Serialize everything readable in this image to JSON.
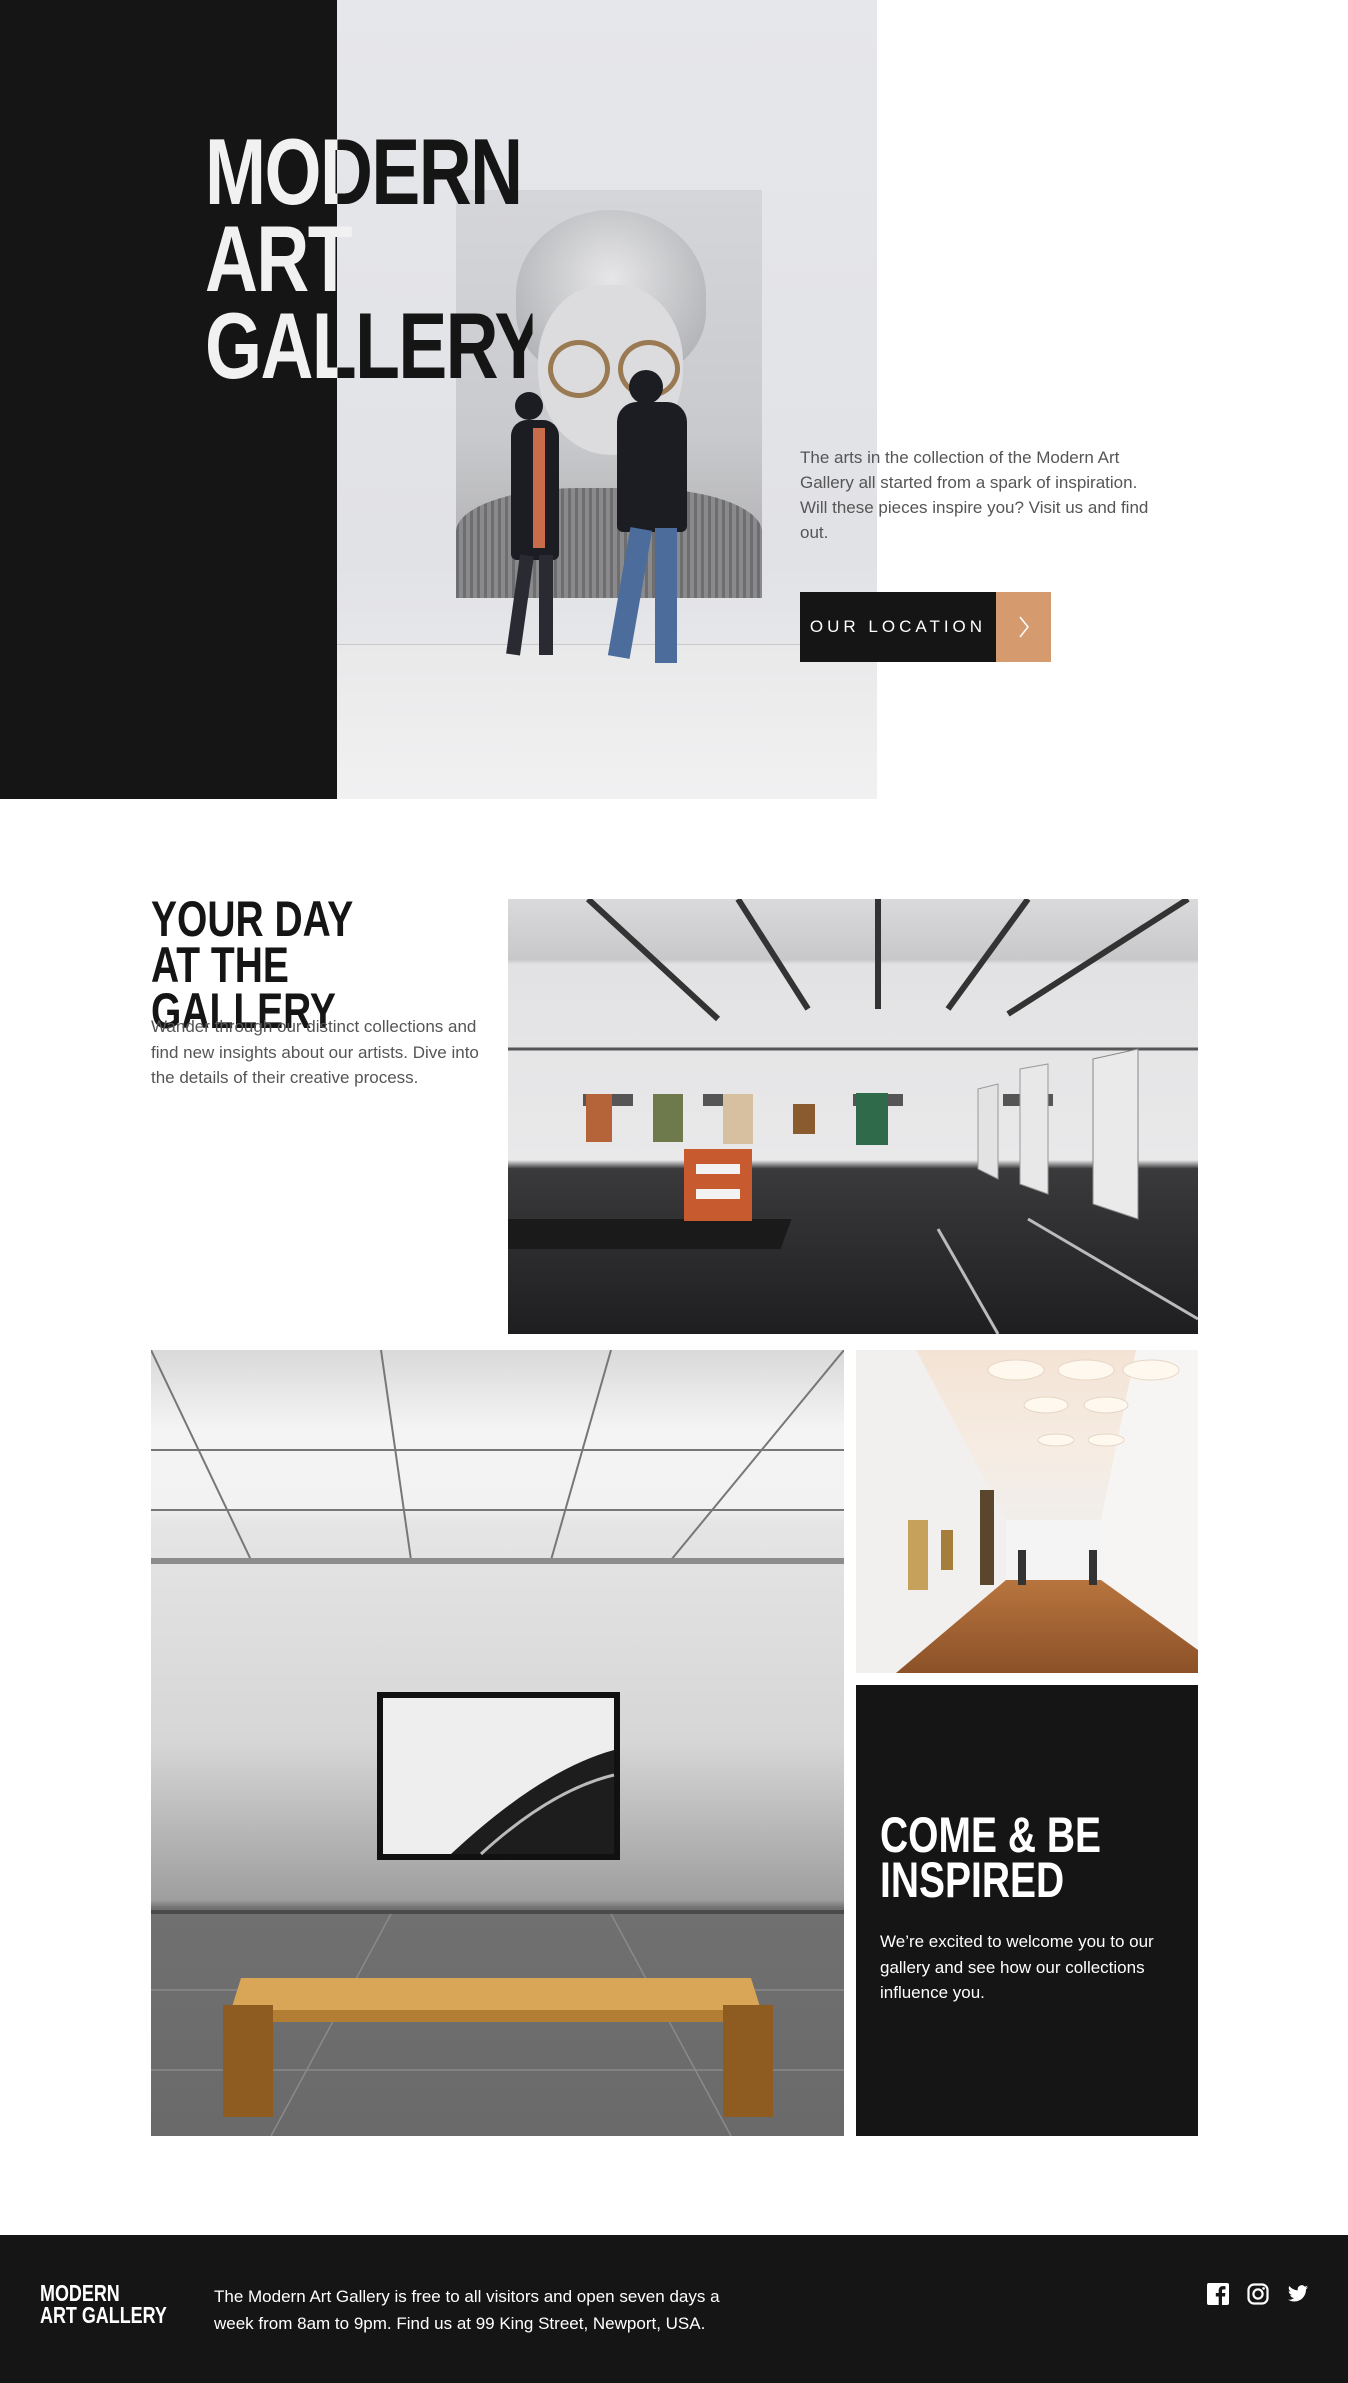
{
  "hero": {
    "title_line1": "MODERN",
    "title_line2": "ART",
    "title_line3": "GALLERY",
    "description": "The arts in the collection of the Modern Art Gallery all started from a spark of inspiration. Will these pieces inspire you? Visit us and find out.",
    "button_label": "OUR LOCATION",
    "button_arrow": "›"
  },
  "day": {
    "title_line1": "YOUR DAY",
    "title_line2": "AT THE GALLERY",
    "description": "Wander through our distinct collections and find new insights about our artists. Dive into the details of their creative process."
  },
  "inspire": {
    "title_line1": "COME & BE",
    "title_line2": "INSPIRED",
    "description": "We’re excited to welcome you to our gallery and see how our collections influence you."
  },
  "footer": {
    "logo_line1": "MODERN",
    "logo_line2": "ART GALLERY",
    "text": "The Modern Art Gallery is free to all visitors and open seven days a week from 8am to 9pm. Find us at 99 King Street, Newport, USA.",
    "social": [
      "facebook-icon",
      "instagram-icon",
      "twitter-icon"
    ]
  },
  "colors": {
    "dark": "#151515",
    "accent": "#d69a6f",
    "body_text": "#555555",
    "white": "#ffffff"
  }
}
